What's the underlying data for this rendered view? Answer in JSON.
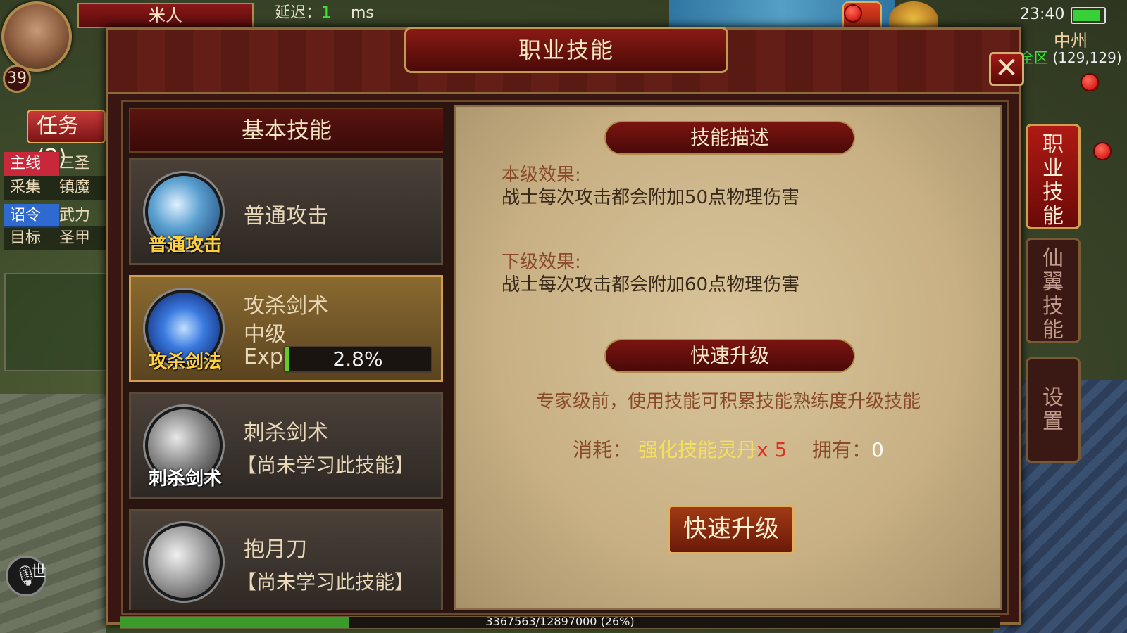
{
  "hud": {
    "player_name": "米人",
    "level": "39",
    "latency_label": "延迟：",
    "latency_value": "1",
    "latency_unit": "ms",
    "task_button": "任务(2)",
    "quests": [
      {
        "tag": "主线",
        "text": "三圣"
      },
      {
        "tag": "采集",
        "text": "镇魔"
      },
      {
        "tag": "诏令",
        "text": "武力"
      },
      {
        "tag": "目标",
        "text": "圣甲"
      }
    ],
    "world_chat": "世",
    "time": "23:40",
    "map_name": "中州",
    "zone_label": "全区",
    "coords": "(129,129)",
    "battery_level": 0.9
  },
  "dialog": {
    "title": "职业技能",
    "close_icon": "close-icon",
    "left_header": "基本技能",
    "skills": [
      {
        "name": "普通攻击",
        "caption": "普通攻击",
        "level": "",
        "status": "",
        "icon": "sword-slash-icon"
      },
      {
        "name": "攻杀剑术",
        "caption": "攻杀剑法",
        "level": "中级",
        "exp_label": "Exp",
        "exp_text": "2.8%",
        "exp_fraction": 0.028,
        "icon": "blue-sword-icon"
      },
      {
        "name": "刺杀剑术",
        "caption": "刺杀剑术",
        "status": "【尚未学习此技能】",
        "icon": "thrust-sword-icon"
      },
      {
        "name": "抱月刀",
        "caption": "",
        "status": "【尚未学习此技能】",
        "icon": "crescent-blade-icon"
      }
    ],
    "desc_header": "技能描述",
    "current_label": "本级效果:",
    "current_text": "战士每次攻击都会附加50点物理伤害",
    "next_label": "下级效果:",
    "next_text": "战士每次攻击都会附加60点物理伤害",
    "upgrade_header": "快速升级",
    "upgrade_note": "专家级前，使用技能可积累技能熟练度升级技能",
    "cost_label": "消耗：",
    "cost_item": "强化技能灵丹",
    "cost_qty": "x 5",
    "own_label": "拥有：",
    "own_value": "0",
    "upgrade_button": "快速升级"
  },
  "side_tabs": [
    {
      "label": "职业技能",
      "active": true
    },
    {
      "label": "仙翼技能",
      "active": false
    },
    {
      "label": "设置",
      "active": false
    }
  ],
  "xp": {
    "text": "3367563/12897000 (26%)",
    "fraction": 0.26
  },
  "colors": {
    "accent_red": "#8a1a14",
    "gold_border": "#c09a50",
    "exp_green": "#60d020",
    "parchment": "#d8c49a"
  }
}
